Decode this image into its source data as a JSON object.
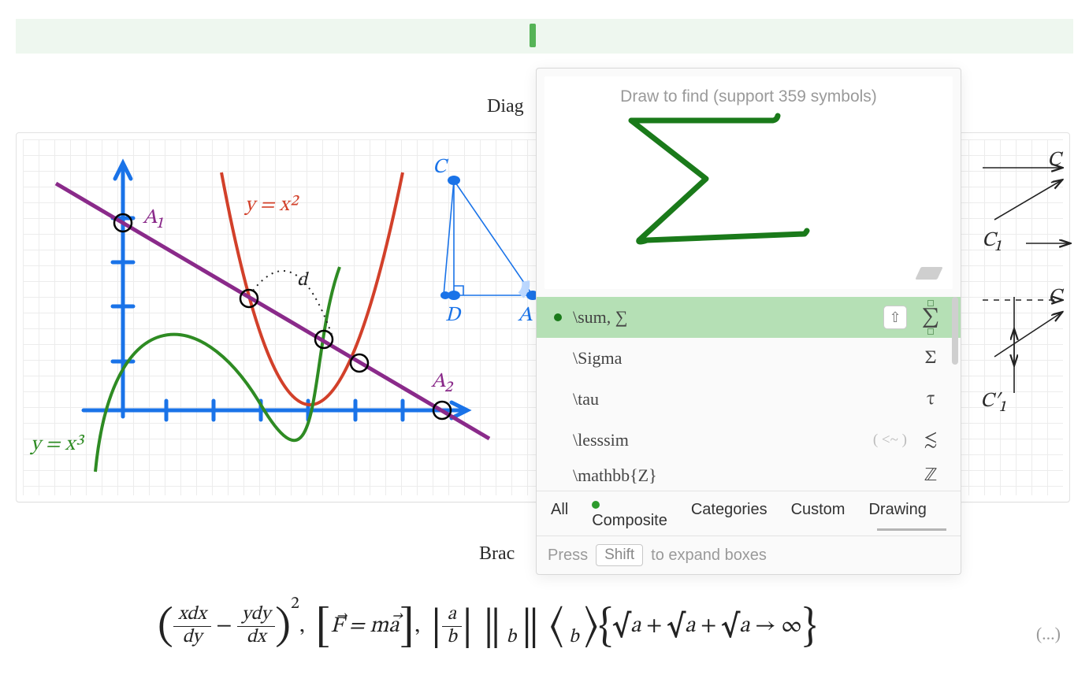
{
  "headings": {
    "diagram": "Diag",
    "brac": "Brac"
  },
  "panel": {
    "placeholder": "Draw to find (support 359 symbols)",
    "results": [
      {
        "name": "\\sum, ∑",
        "glyph": "∑",
        "keyhint": "",
        "shift": true,
        "selected": true,
        "boxed": true
      },
      {
        "name": "\\Sigma",
        "glyph": "Σ",
        "keyhint": "",
        "shift": false,
        "selected": false,
        "boxed": false
      },
      {
        "name": "\\tau",
        "glyph": "τ",
        "keyhint": "",
        "shift": false,
        "selected": false,
        "boxed": false
      },
      {
        "name": "\\lesssim",
        "glyph": "≲",
        "keyhint": "( <~ )",
        "shift": false,
        "selected": false,
        "boxed": false
      },
      {
        "name": "\\mathbb{Z}",
        "glyph": "ℤ",
        "keyhint": "",
        "shift": false,
        "selected": false,
        "boxed": false
      }
    ],
    "tabs": {
      "all": "All",
      "composite": "Composite",
      "categories": "Categories",
      "custom": "Custom",
      "drawing": "Drawing"
    },
    "hint_pre": "Press",
    "hint_key": "Shift",
    "hint_post": "to expand boxes"
  },
  "graph": {
    "curve_red_label": "y = x²",
    "curve_green_label": "y = x³",
    "pointA1": "A₁",
    "pointA2": "A₂",
    "distance": "d",
    "tri_C": "C",
    "tri_D": "D",
    "tri_A": "A"
  },
  "category_diagram": {
    "C": "C",
    "C1": "C₁",
    "Cb": "C",
    "C1p": "C′₁"
  },
  "formula": {
    "frac1_num": "xdx",
    "frac1_den": "dy",
    "frac2_num": "ydy",
    "frac2_den": "dx",
    "pow": "2",
    "F_eq": "F⃗ = ma⃗",
    "a": "a",
    "b": "b",
    "surd_a": "a",
    "infty": "∞"
  },
  "ellipsis": "(...)"
}
